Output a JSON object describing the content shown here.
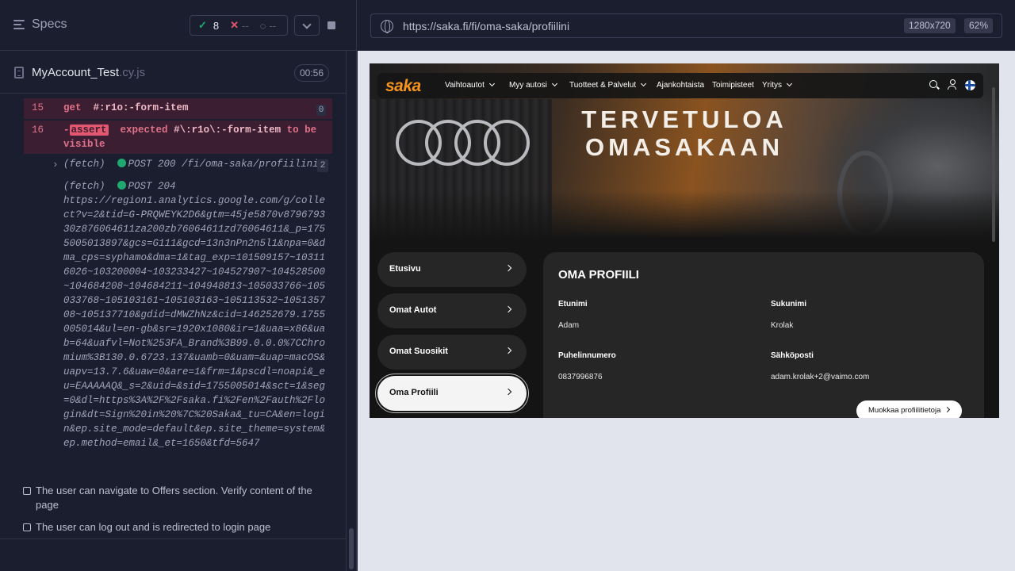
{
  "runner": {
    "specs_title": "Specs",
    "stats": {
      "passed": "8",
      "failed": "--",
      "pending": "--"
    },
    "spec_file": {
      "name": "MyAccount_Test",
      "ext": ".cy.js",
      "duration": "00:56"
    },
    "commands": [
      {
        "num": "15",
        "name": "get",
        "arg": "#:r1o:-form-item",
        "badge": "0"
      },
      {
        "num": "16",
        "prefix": "-",
        "label": "assert",
        "text1": "expected",
        "arg": "#\\:r1o\\:-form-item",
        "text2": "to be visible"
      }
    ],
    "fetches": [
      {
        "type": "(fetch)",
        "method": "POST 200 /fi/oma-saka/profiilini",
        "badge": "2"
      },
      {
        "type": "(fetch)",
        "method": "POST 204",
        "url": "https://region1.analytics.google.com/g/collect?v=2&tid=G-PRQWEYK2D6&gtm=45je5870v879679330z876064611za200zb76064611zd76064611&_p=1755005013897&gcs=G111&gcd=13n3nPn2n5l1&npa=0&dma_cps=syphamo&dma=1&tag_exp=101509157~103116026~103200004~103233427~104527907~104528500~104684208~104684211~104948813~105033766~105033768~105103161~105103163~105113532~105135708~105137710&gdid=dMWZhNz&cid=146252679.1755005014&ul=en-gb&sr=1920x1080&ir=1&uaa=x86&uab=64&uafvl=Not%253FA_Brand%3B99.0.0.0%7CChromium%3B130.0.6723.137&uamb=0&uam=&uap=macOS&uapv=13.7.6&uaw=0&are=1&frm=1&pscdl=noapi&_eu=EAAAAAQ&_s=2&uid=&sid=1755005014&sct=1&seg=0&dl=https%3A%2F%2Fsaka.fi%2Fen%2Fauth%2Flogin&dt=Sign%20in%20%7C%20Saka&_tu=CA&en=login&ep.site_mode=default&ep.site_theme=system&ep.method=email&_et=1650&tfd=5647"
      }
    ],
    "tests": [
      "The user can navigate to Offers section. Verify content of the page",
      "The user can log out and is redirected to login page"
    ]
  },
  "browser": {
    "url": "https://saka.fi/fi/oma-saka/profiilini",
    "viewport": "1280x720",
    "zoom": "62%"
  },
  "site": {
    "logo": "saka",
    "nav": [
      "Vaihtoautot",
      "Myy autosi",
      "Tuotteet & Palvelut",
      "Ajankohtaista",
      "Toimipisteet",
      "Yritys"
    ],
    "hero_line1": "TERVETULOA",
    "hero_line2": "OMASAKAAN",
    "side_menu": [
      "Etusivu",
      "Omat Autot",
      "Omat Suosikit",
      "Oma Profiili"
    ],
    "profile": {
      "title": "OMA PROFIILI",
      "first_name_label": "Etunimi",
      "first_name": "Adam",
      "last_name_label": "Sukunimi",
      "last_name": "Krolak",
      "phone_label": "Puhelinnumero",
      "phone": "0837996876",
      "email_label": "Sähköposti",
      "email": "adam.krolak+2@vaimo.com",
      "edit_button": "Muokkaa profiilitietoja"
    }
  },
  "colors": {
    "brand_orange": "#f7941d",
    "pass_green": "#1fa971",
    "fail_red": "#e45770"
  }
}
